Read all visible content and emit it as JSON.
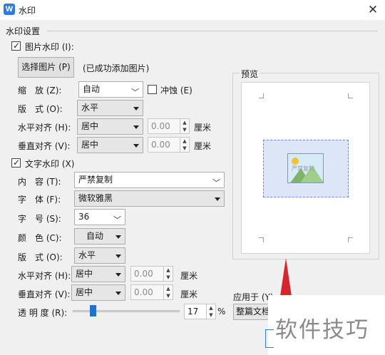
{
  "window": {
    "title": "水印",
    "app_icon_letter": "W",
    "close_glyph": "✕"
  },
  "section_title": "水印设置",
  "picture_watermark": {
    "label": "图片水印 (I):",
    "checked": true,
    "select_button": "选择图片 (P)",
    "status": "(已成功添加图片)",
    "scale_label": "缩　放 (Z):",
    "scale_value": "自动",
    "washout_label": "冲蚀 (E)",
    "washout_checked": false,
    "layout_label": "版　式 (O):",
    "layout_value": "水平",
    "halign_label": "水平对齐 (H):",
    "halign_value": "居中",
    "halign_offset": "0.00",
    "valign_label": "垂直对齐 (V):",
    "valign_value": "居中",
    "valign_offset": "0.00",
    "unit": "厘米"
  },
  "text_watermark": {
    "label": "文字水印 (X)",
    "checked": true,
    "content_label": "内　容 (T):",
    "content_value": "严禁复制",
    "font_label": "字　体 (F):",
    "font_value": "微软雅黑",
    "size_label": "字　号 (S):",
    "size_value": "36",
    "color_label": "颜　色 (C):",
    "color_value": "自动",
    "layout_label": "版　式 (O):",
    "layout_value": "水平",
    "halign_label": "水平对齐 (H):",
    "halign_value": "居中",
    "halign_offset": "0.00",
    "valign_label": "垂直对齐 (V):",
    "valign_value": "居中",
    "valign_offset": "0.00",
    "unit": "厘米",
    "transparency_label": "透 明 度 (R):",
    "transparency_value": "17",
    "transparency_unit": "%",
    "transparency_fraction": 0.17
  },
  "preview": {
    "label": "预览",
    "watermark_text": "严禁复制"
  },
  "apply_to": {
    "label": "应用于 (Y):",
    "value": "整篇文档"
  },
  "site_watermark": "软件技巧",
  "colors": {
    "accent": "#2f7bd9",
    "slider": "#1f73c9",
    "red_arrow": "#d7262b"
  }
}
